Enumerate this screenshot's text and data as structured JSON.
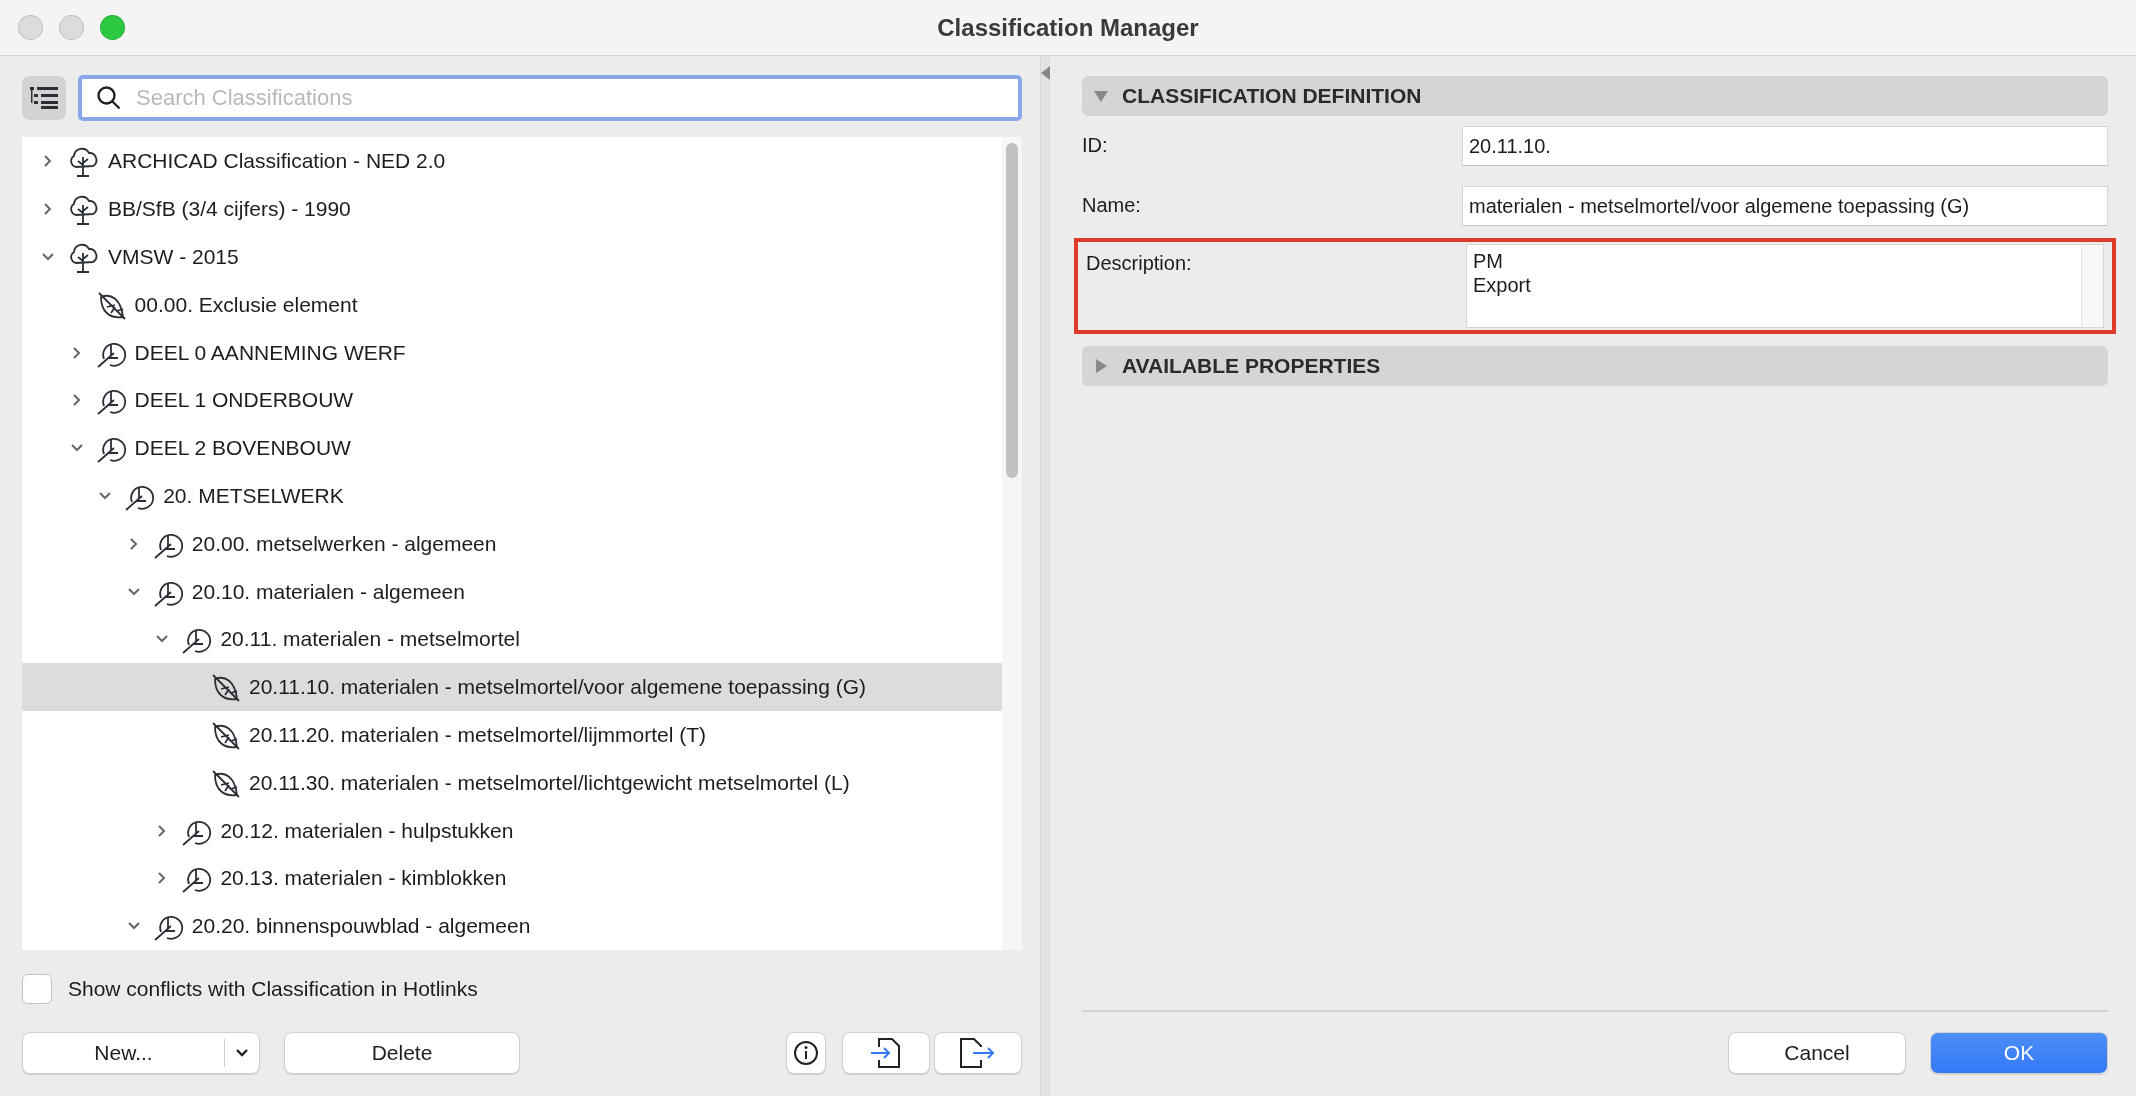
{
  "window": {
    "title": "Classification Manager"
  },
  "search": {
    "placeholder": "Search Classifications"
  },
  "tree": [
    {
      "label": "ARCHICAD Classification - NED 2.0",
      "kind": "system",
      "expanded": false,
      "selected": false
    },
    {
      "label": "BB/SfB (3/4 cijfers) - 1990",
      "kind": "system",
      "expanded": false,
      "selected": false
    },
    {
      "label": "VMSW - 2015",
      "kind": "system",
      "expanded": true,
      "selected": false,
      "children": [
        {
          "label": "00.00. Exclusie element",
          "kind": "item",
          "selected": false
        },
        {
          "label": "DEEL 0 AANNEMING WERF",
          "kind": "group",
          "expanded": false,
          "selected": false
        },
        {
          "label": "DEEL 1 ONDERBOUW",
          "kind": "group",
          "expanded": false,
          "selected": false
        },
        {
          "label": "DEEL 2 BOVENBOUW",
          "kind": "group",
          "expanded": true,
          "selected": false,
          "children": [
            {
              "label": "20. METSELWERK",
              "kind": "group",
              "expanded": true,
              "selected": false,
              "children": [
                {
                  "label": "20.00. metselwerken - algemeen",
                  "kind": "group",
                  "expanded": false,
                  "selected": false
                },
                {
                  "label": "20.10. materialen - algemeen",
                  "kind": "group",
                  "expanded": true,
                  "selected": false,
                  "children": [
                    {
                      "label": "20.11. materialen - metselmortel",
                      "kind": "group",
                      "expanded": true,
                      "selected": false,
                      "children": [
                        {
                          "label": "20.11.10. materialen - metselmortel/voor algemene toepassing (G)",
                          "kind": "item",
                          "selected": true
                        },
                        {
                          "label": "20.11.20. materialen - metselmortel/lijmmortel (T)",
                          "kind": "item",
                          "selected": false
                        },
                        {
                          "label": "20.11.30. materialen - metselmortel/lichtgewicht metselmortel (L)",
                          "kind": "item",
                          "selected": false
                        }
                      ]
                    },
                    {
                      "label": "20.12. materialen - hulpstukken",
                      "kind": "group",
                      "expanded": false,
                      "selected": false
                    },
                    {
                      "label": "20.13. materialen - kimblokken",
                      "kind": "group",
                      "expanded": false,
                      "selected": false
                    }
                  ]
                },
                {
                  "label": "20.20. binnenspouwblad - algemeen",
                  "kind": "group",
                  "expanded": true,
                  "selected": false
                }
              ]
            }
          ]
        }
      ]
    }
  ],
  "conflicts_checkbox": {
    "label": "Show conflicts with Classification in Hotlinks",
    "checked": false
  },
  "left_buttons": {
    "new": "New...",
    "delete": "Delete"
  },
  "sections": [
    {
      "title": "CLASSIFICATION DEFINITION",
      "expanded": true,
      "fields": [
        {
          "label": "ID:",
          "value": "20.11.10.",
          "kind": "line",
          "highlighted": false
        },
        {
          "label": "Name:",
          "value": "materialen - metselmortel/voor algemene toepassing (G)",
          "kind": "line",
          "highlighted": false
        },
        {
          "label": "Description:",
          "value": "PM\nExport",
          "kind": "multiline",
          "highlighted": true
        }
      ]
    },
    {
      "title": "AVAILABLE PROPERTIES",
      "expanded": false
    }
  ],
  "dialog_buttons": {
    "cancel": "Cancel",
    "ok": "OK"
  }
}
